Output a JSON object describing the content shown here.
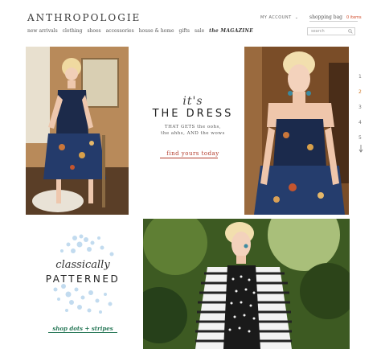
{
  "header": {
    "logo": "ANTHROPOLOGIE",
    "account_label": "MY ACCOUNT",
    "bag_label": "shopping bag",
    "bag_items": "0 items",
    "search_placeholder": "search"
  },
  "nav": {
    "items": [
      "new arrivals",
      "clothing",
      "shoes",
      "accessories",
      "house & home",
      "gifts",
      "sale",
      "the MAGAZINE"
    ]
  },
  "promo_dress": {
    "line1": "it's",
    "line2": "THE DRESS",
    "tagline1": "THAT GETS the oohs,",
    "tagline2": "the ahhs, AND the wows",
    "cta": "find yours today"
  },
  "pager": {
    "pages": [
      "1",
      "2",
      "3",
      "4",
      "5"
    ],
    "active_index": 1
  },
  "promo_pattern": {
    "line1": "classically",
    "line2": "PATTERNED",
    "cta": "shop dots + stripes"
  },
  "colors": {
    "accent_red": "#b23a2a",
    "accent_green": "#2b7a5a",
    "pager_active": "#d07a2a",
    "dots_blue": "#bcd8ee"
  }
}
